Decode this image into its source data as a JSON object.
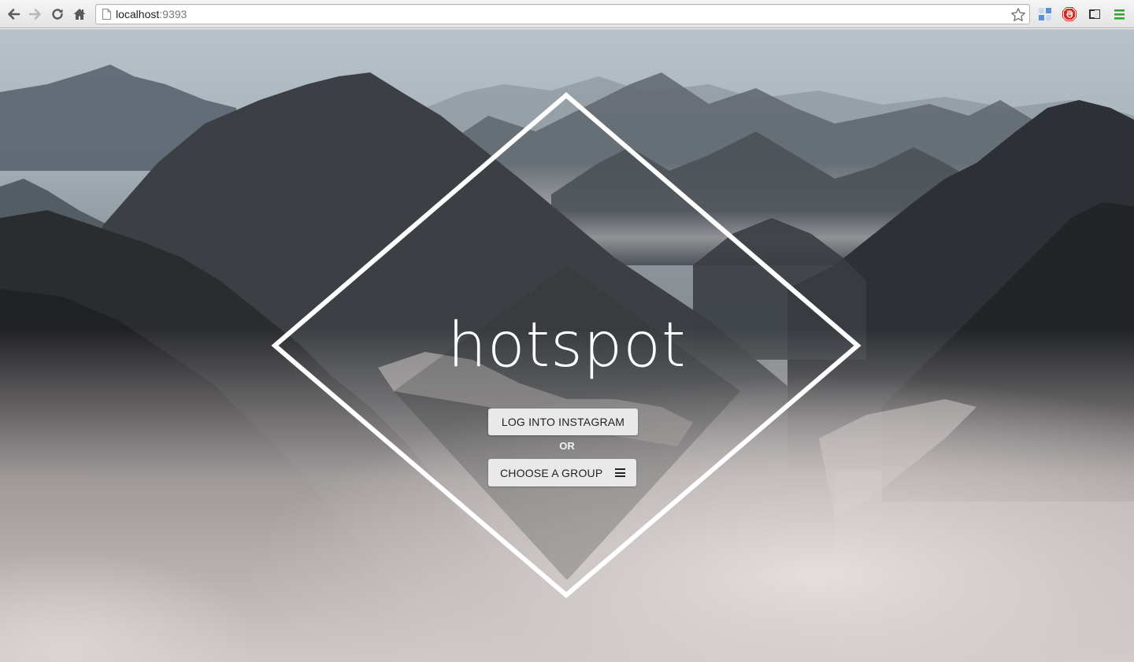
{
  "browser": {
    "url_host": "localhost",
    "url_port": ":9393",
    "icons": {
      "back": "back-arrow-icon",
      "forward": "forward-arrow-icon",
      "reload": "reload-icon",
      "home": "home-icon",
      "bookmark": "star-icon",
      "extensions": [
        "extension-grid-icon",
        "adblock-icon",
        "cast-icon",
        "chrome-menu-icon"
      ]
    }
  },
  "hero": {
    "title": "hotspot",
    "login_button": "LOG INTO INSTAGRAM",
    "separator": "OR",
    "group_button": "CHOOSE A GROUP",
    "group_button_icon": "hamburger-menu-icon"
  },
  "colors": {
    "diamond_stroke": "#ffffff",
    "button_bg": "#e9e9e9",
    "button_text": "#222222"
  }
}
